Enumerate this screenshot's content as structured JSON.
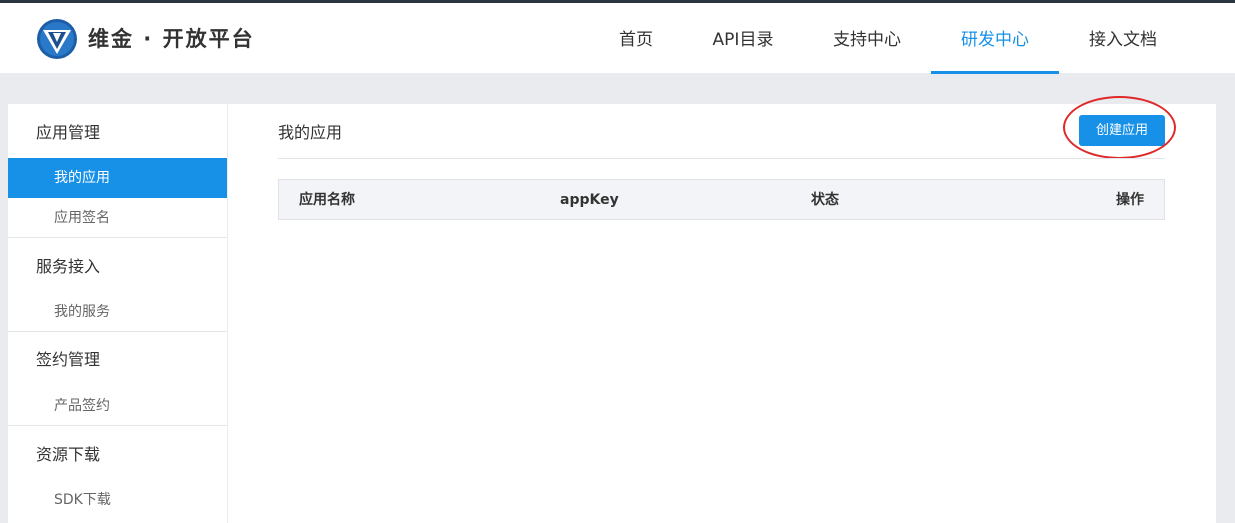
{
  "header": {
    "brand": "维金 · 开放平台",
    "nav": [
      "首页",
      "API目录",
      "支持中心",
      "研发中心",
      "接入文档"
    ],
    "active_nav": "研发中心"
  },
  "sidebar": {
    "groups": [
      {
        "title": "应用管理",
        "items": [
          "我的应用",
          "应用签名"
        ]
      },
      {
        "title": "服务接入",
        "items": [
          "我的服务"
        ]
      },
      {
        "title": "签约管理",
        "items": [
          "产品签约"
        ]
      },
      {
        "title": "资源下载",
        "items": [
          "SDK下载"
        ]
      }
    ],
    "active_item": "我的应用"
  },
  "main": {
    "title": "我的应用",
    "create_button": "创建应用",
    "table": {
      "columns": [
        "应用名称",
        "appKey",
        "状态",
        "操作"
      ],
      "rows": []
    }
  },
  "colors": {
    "accent": "#1791e8",
    "annotation": "#e02a2a",
    "top_bar": "#2b3540"
  },
  "icons": {
    "logo": "brand-logo-icon"
  }
}
